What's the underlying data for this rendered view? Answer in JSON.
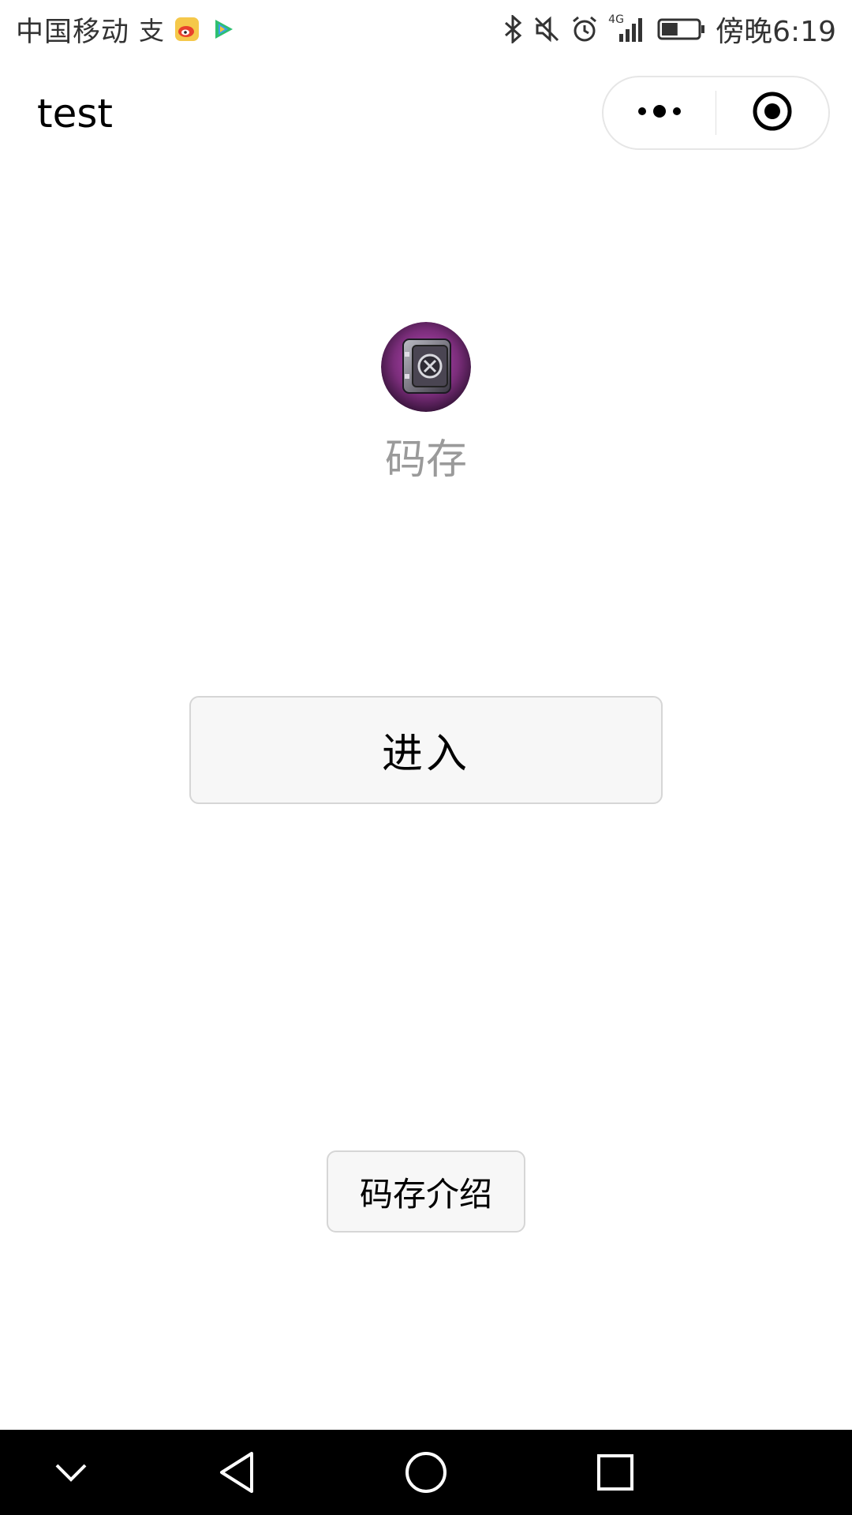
{
  "status_bar": {
    "carrier": "中国移动",
    "carrier_extra": "支",
    "network": "4G",
    "time": "傍晚6:19",
    "battery_percent": 45,
    "icons": [
      "weibo-icon",
      "video-app-icon",
      "bluetooth-icon",
      "mute-icon",
      "alarm-icon",
      "signal-icon",
      "battery-icon"
    ]
  },
  "nav_bar": {
    "title": "test",
    "menu_icon": "more-dots-icon",
    "close_icon": "target-close-icon"
  },
  "app": {
    "logo_icon": "safe-vault-icon",
    "name": "码存"
  },
  "buttons": {
    "enter_label": "进入",
    "intro_label": "码存介绍"
  },
  "system_nav": {
    "icons": [
      "chevron-down-icon",
      "back-triangle-icon",
      "home-circle-icon",
      "recents-square-icon"
    ]
  },
  "colors": {
    "app_name": "#9a9a9a",
    "button_bg": "#f7f7f7",
    "button_border": "#d6d6d6",
    "logo_purple": "#7a2d7a"
  }
}
